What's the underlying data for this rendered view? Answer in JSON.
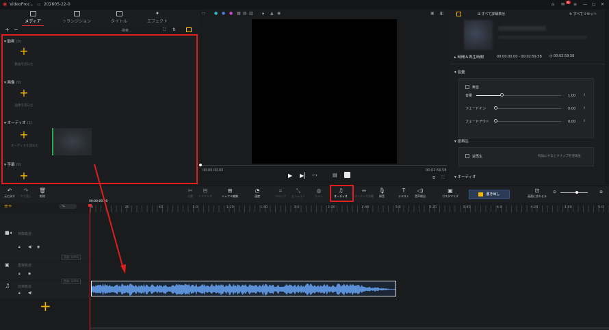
{
  "titlebar": {
    "app": "VideoProc",
    "project": "202605-22-0",
    "badge": "6"
  },
  "left_tabs": [
    {
      "label": "メディア",
      "active": true
    },
    {
      "label": "トランジション",
      "active": false
    },
    {
      "label": "タイトル",
      "active": false
    },
    {
      "label": "エフェクト",
      "active": false
    }
  ],
  "media_toolbar": {
    "add": "+",
    "remove": "−",
    "search_placeholder": "検索..."
  },
  "sections": [
    {
      "title": "動画",
      "count": "(0)",
      "add_label": "動画を読込む"
    },
    {
      "title": "画像",
      "count": "(0)",
      "add_label": "画像を読込む"
    },
    {
      "title": "オーディオ",
      "count": "(1)",
      "add_label": "オーディオを読込む"
    },
    {
      "title": "字幕",
      "count": "(0)",
      "add_label": ""
    }
  ],
  "preview": {
    "time_current": "00:00:00.00",
    "time_total": "00:02:59.58"
  },
  "right_panel": {
    "show_all": "すべて詳細表示",
    "reset_all": "すべてリセット",
    "duration_label": "時間＆再生時間",
    "duration_value": "00:00:00.00 - 00:02:59.58",
    "duration_length": "00:02:59.58",
    "volume_section": "音量",
    "mute_label": "無音",
    "volume_label": "音量",
    "volume_value": "1.00",
    "volume_level": 0.3,
    "fadein_label": "フェードイン",
    "fadein_value": "0.00",
    "fadeout_label": "フェードアウト",
    "fadeout_value": "0.00",
    "reverse_section": "逆再生",
    "reverse_label": "逆再生",
    "reverse_hint": "有効にするとクリップを逆再生",
    "audio_section": "オーディオ"
  },
  "toolbar": {
    "undo": "元に戻す",
    "redo": "やり直し",
    "delete": "削除",
    "items": [
      "分割",
      "トリミング",
      "シャフル編集",
      "速度",
      "クロップ",
      "モーション",
      "カラー",
      "オーディオ",
      "オーディオ分離",
      "録音",
      "テキスト",
      "音声検出",
      "カスタマイズ"
    ],
    "export": "書き出し",
    "fit": "画面に合わせる"
  },
  "timeline": {
    "playhead_time": "00:00:00.00",
    "ruler": [
      "0",
      "20",
      "40",
      "1:0",
      "1:20",
      "1:40",
      "2:0",
      "2:20",
      "2:40",
      "3:0",
      "3:20",
      "3:40",
      "4:0",
      "4:20",
      "4:40",
      "5:0"
    ],
    "tracks": [
      {
        "name": "映像軌道",
        "meta": "音量: 100%"
      },
      {
        "name": "重複軌道",
        "meta": ""
      },
      {
        "name": "音楽軌道",
        "meta": "音量: 100%"
      }
    ]
  }
}
